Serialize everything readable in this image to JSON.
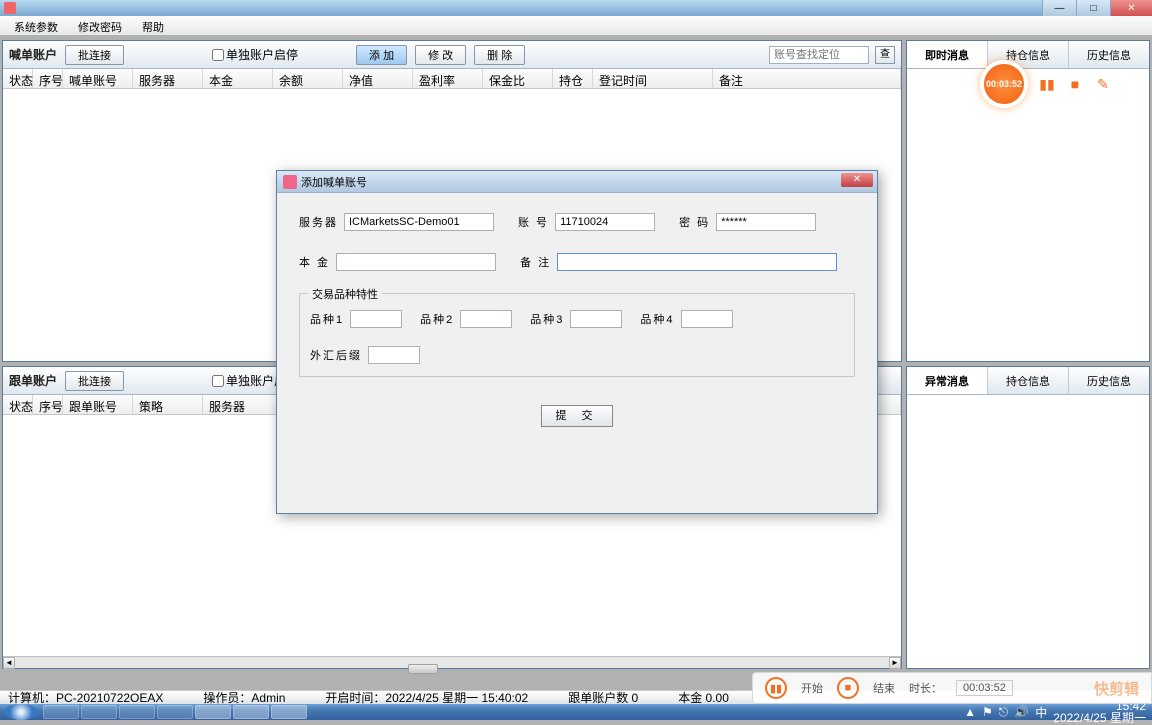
{
  "window": {
    "minimize_glyph": "—",
    "maximize_glyph": "□",
    "close_glyph": "✕"
  },
  "menubar": {
    "items": [
      "系统参数",
      "修改密码",
      "帮助"
    ]
  },
  "main_panel_top": {
    "title": "喊单账户",
    "btn_batch": "批连接",
    "chk_label": "单独账户启停",
    "btn_add": "添   加",
    "btn_edit": "修   改",
    "btn_del": "删   除",
    "search_ph": "账号查找定位",
    "search_btn": "查",
    "cols": [
      "状态",
      "序号",
      "喊单账号",
      "服务器",
      "本金",
      "余额",
      "净值",
      "盈利率",
      "保金比",
      "持仓",
      "登记时间",
      "备注"
    ]
  },
  "main_panel_bottom": {
    "title": "跟单账户",
    "btn_batch": "批连接",
    "chk_label": "单独账户启停",
    "cols": [
      "状态",
      "序号",
      "跟单账号",
      "策略",
      "服务器"
    ]
  },
  "right_top_tabs": [
    "即时消息",
    "持仓信息",
    "历史信息"
  ],
  "right_bottom_tabs": [
    "异常消息",
    "持仓信息",
    "历史信息"
  ],
  "dialog": {
    "title": "添加喊单账号",
    "lbl_server": "服务器",
    "val_server": "ICMarketsSC-Demo01",
    "lbl_account": "账  号",
    "val_account": "11710024",
    "lbl_pwd": "密  码",
    "val_pwd": "******",
    "lbl_capital": "本  金",
    "lbl_note": "备  注",
    "legend": "交易品种特性",
    "lbl_sym1": "品种1",
    "lbl_sym2": "品种2",
    "lbl_sym3": "品种3",
    "lbl_sym4": "品种4",
    "lbl_fx": "外汇后缀",
    "btn_submit": "提  交",
    "close_glyph": "✕"
  },
  "statusbar": {
    "computer": "计算机：PC-20210722OEAX",
    "operator": "操作员：Admin",
    "open_time": "开启时间：2022/4/25 星期一 15:40:02",
    "follow_count": "跟单账户数  0",
    "capital": "本金  0.00"
  },
  "tray": {
    "time": "15:42",
    "date": "2022/4/25 星期一"
  },
  "recorder": {
    "timer": "00:03:52",
    "pause_glyph": "▮▮",
    "stop_glyph": "■",
    "edit_glyph": "✎",
    "ctrl_pause_glyph": "▮▮",
    "ctrl_stop_glyph": "■",
    "lbl_start": "开始",
    "lbl_end": "结束",
    "lbl_dur": "时长：",
    "val_dur": "00:03:52",
    "logo": "快剪辑"
  }
}
